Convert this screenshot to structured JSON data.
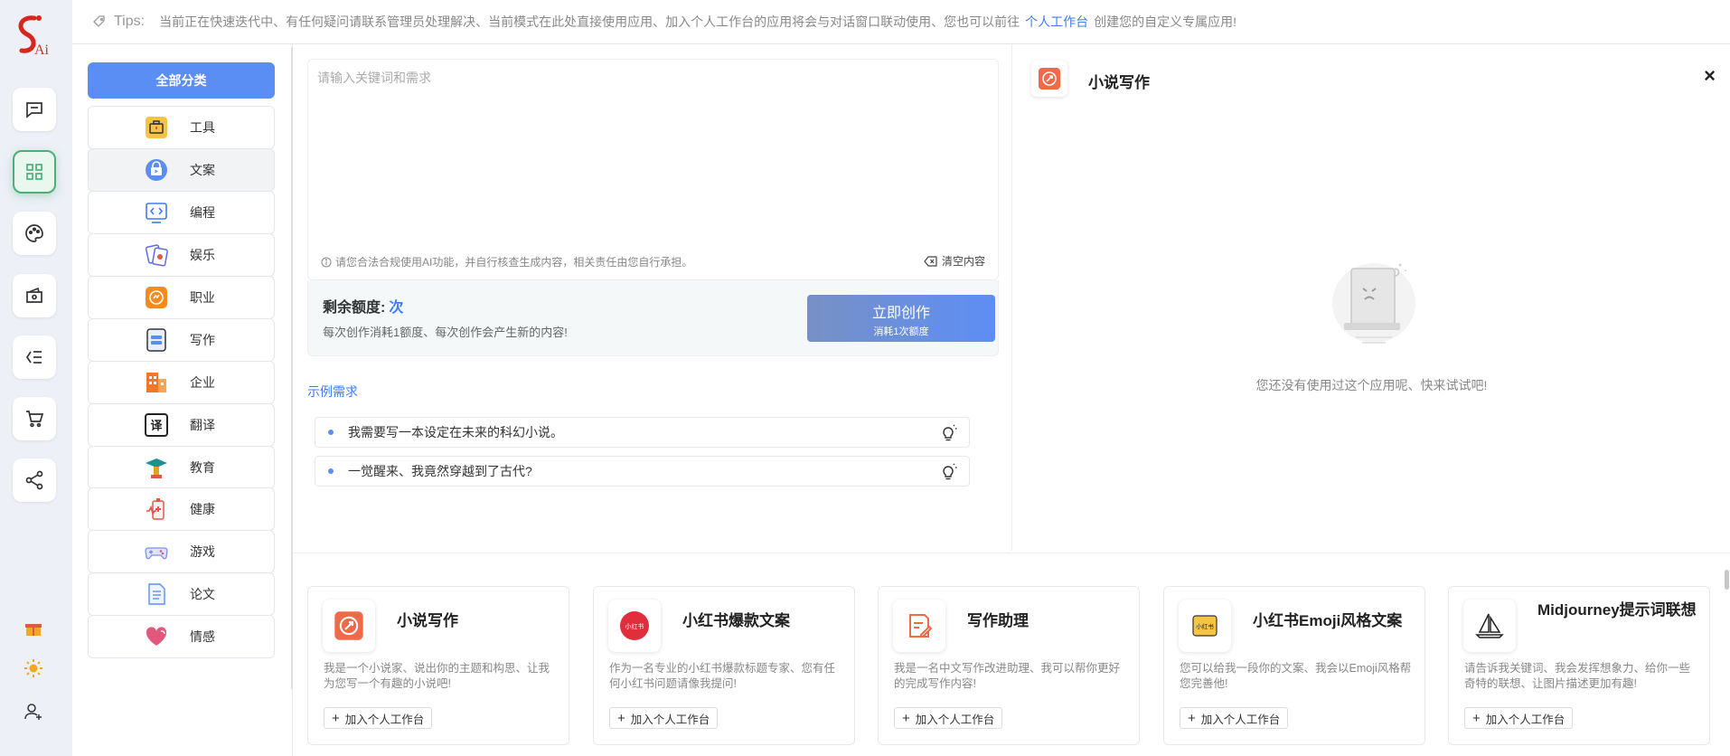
{
  "logo": {
    "text": "Ai"
  },
  "tips": {
    "title": "Tips:",
    "text": "当前正在快速迭代中、有任何疑问请联系管理员处理解决、当前模式在此处直接使用应用、加入个人工作台的应用将会与对话窗口联动使用、您也可以前往",
    "link": "个人工作台",
    "suffix": "创建您的自定义专属应用!"
  },
  "sidebar": {
    "items": [
      {
        "icon": "chat-icon"
      },
      {
        "icon": "apps-grid-icon",
        "active": true
      },
      {
        "icon": "palette-icon"
      },
      {
        "icon": "wallet-icon"
      },
      {
        "icon": "list-icon"
      },
      {
        "icon": "cart-icon"
      },
      {
        "icon": "share-icon"
      }
    ],
    "bottom": [
      {
        "icon": "gift-icon"
      },
      {
        "icon": "sun-icon"
      },
      {
        "icon": "user-plus-icon"
      }
    ]
  },
  "categories": {
    "all_label": "全部分类",
    "items": [
      {
        "label": "工具",
        "icon": "toolbox-icon",
        "color": "#f5c443"
      },
      {
        "label": "文案",
        "icon": "video-lock-icon",
        "color": "#5b8ef5"
      },
      {
        "label": "编程",
        "icon": "code-icon",
        "color": "#3f7cf5"
      },
      {
        "label": "娱乐",
        "icon": "game-cards-icon",
        "color": "#e2574c"
      },
      {
        "label": "职业",
        "icon": "career-icon",
        "color": "#f58a1f"
      },
      {
        "label": "写作",
        "icon": "writing-icon",
        "color": "#5b8ef5"
      },
      {
        "label": "企业",
        "icon": "building-icon",
        "color": "#f5782a"
      },
      {
        "label": "翻译",
        "icon": "translate-icon",
        "color": "#333333"
      },
      {
        "label": "教育",
        "icon": "education-icon",
        "color": "#e8a020"
      },
      {
        "label": "健康",
        "icon": "health-icon",
        "color": "#e2574c"
      },
      {
        "label": "游戏",
        "icon": "gamepad-icon",
        "color": "#7a8ef5"
      },
      {
        "label": "论文",
        "icon": "document-icon",
        "color": "#5b8ef5"
      },
      {
        "label": "情感",
        "icon": "heart-icon",
        "color": "#e2577c"
      }
    ]
  },
  "editor": {
    "placeholder": "请输入关键词和需求",
    "notice": "请您合法合规使用AI功能，并自行核查生成内容，相关责任由您自行承担。",
    "clear_label": "清空内容"
  },
  "quota": {
    "label": "剩余额度:",
    "value": "次",
    "sub": "每次创作消耗1额度、每次创作会产生新的内容!",
    "create_label": "立即创作",
    "create_sub": "消耗1次额度"
  },
  "examples": {
    "title": "示例需求",
    "items": [
      "我需要写一本设定在未来的科幻小说。",
      "一觉醒来、我竟然穿越到了古代?"
    ]
  },
  "panel": {
    "title": "小说写作",
    "close": "×",
    "empty_text": "您还没有使用过这个应用呢、快来试试吧!"
  },
  "cards": [
    {
      "title": "小说写作",
      "desc": "我是一个小说家、说出你的主题和构思、让我为您写一个有趣的小说吧!",
      "add": "加入个人工作台",
      "icon": "novel-icon"
    },
    {
      "title": "小红书爆款文案",
      "desc": "作为一名专业的小红书爆款标题专家、您有任何小红书问题请像我提问!",
      "add": "加入个人工作台",
      "icon": "xiaohongshu-icon",
      "icon_text": "小红书"
    },
    {
      "title": "写作助理",
      "desc": "我是一名中文写作改进助理、我可以帮你更好的完成写作内容!",
      "add": "加入个人工作台",
      "icon": "edit-doc-icon"
    },
    {
      "title": "小红书Emoji风格文案",
      "desc": "您可以给我一段你的文案、我会以Emoji风格帮您完善他!",
      "add": "加入个人工作台",
      "icon": "xiaohongshu-emoji-icon",
      "icon_text": "小红书"
    },
    {
      "title": "Midjourney提示词联想",
      "desc": "请告诉我关键词、我会发挥想象力、给你一些奇特的联想、让图片描述更加有趣!",
      "add": "加入个人工作台",
      "icon": "sailboat-icon"
    }
  ]
}
